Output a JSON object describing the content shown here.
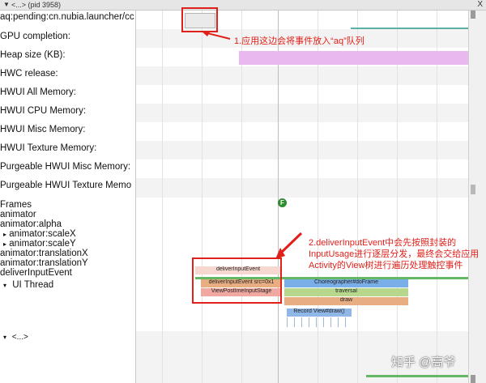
{
  "window": {
    "title": "<...> (pid 3958)",
    "close": "X"
  },
  "tracks": [
    "aq:pending:cn.nubia.launcher/cc",
    "GPU completion:",
    "Heap size (KB):",
    "HWC release:",
    "HWUI All Memory:",
    "HWUI CPU Memory:",
    "HWUI Misc Memory:",
    "HWUI Texture Memory:",
    "Purgeable HWUI Misc Memory:",
    "Purgeable HWUI Texture Memo"
  ],
  "groups": {
    "frames": "Frames",
    "animator": "animator",
    "animator_alpha": "animator:alpha",
    "scale_x": "animator:scaleX",
    "scale_y": "animator:scaleY",
    "translation_x": "animator:translationX",
    "translation_y": "animator:translationY",
    "deliver_input": "deliverInputEvent",
    "ui_thread": "UI Thread",
    "collapsed": "<...>"
  },
  "frame_marker": "F",
  "slices": {
    "deliver_input_event": "deliverInputEvent",
    "deliver_input_event_src": "deliverInputEvent src=0x1",
    "view_post_ime": "ViewPostImeInputStage",
    "choreographer": "Choreographer#doFrame",
    "traversal": "traversal",
    "draw": "draw",
    "record_view": "Record View#draw()"
  },
  "annotations": {
    "note1": "1.应用这边会将事件放入“aq”队列",
    "note2_line1": "2.deliverInputEvent中会先按照封装的",
    "note2_line2": "InputUsage进行逐层分发，最终会交给应用",
    "note2_line3": "Activity的View树进行遍历处理触控事件"
  },
  "watermark": "知乎 @高爷",
  "colors": {
    "annotation_red": "#e0201a",
    "heap_fill": "#e8b8ee",
    "frame_green": "#2e8b2e"
  }
}
